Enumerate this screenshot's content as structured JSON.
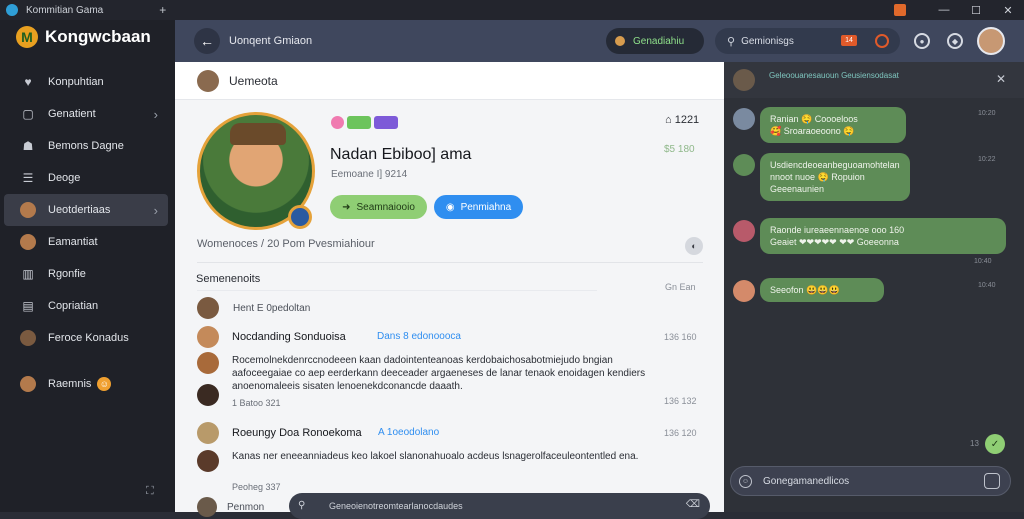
{
  "window": {
    "title": "Kommitian Gama",
    "tab_plus": "+",
    "minimize": "—",
    "maximize": "☐",
    "close": "✕"
  },
  "brand": {
    "name": "Kongwcbaan"
  },
  "sidebar": {
    "items": [
      {
        "label": "Konpuhtian"
      },
      {
        "label": "Genatient"
      },
      {
        "label": "Bemons Dagne"
      },
      {
        "label": "Deoge"
      },
      {
        "label": "Ueotdertiaas"
      },
      {
        "label": "Eamantiat"
      },
      {
        "label": "Rgonfie"
      },
      {
        "label": "Copriatian"
      },
      {
        "label": "Feroce Konadus"
      },
      {
        "label": "Raemnis"
      }
    ]
  },
  "topbar": {
    "title": "Uonqent Gmiaon",
    "status_pill": "Genadiahiu",
    "search_text": "Gemionisgs",
    "search_badge": "14"
  },
  "channel": {
    "title": "Uemeota"
  },
  "profile": {
    "name": "Nadan Ebiboo] ama",
    "subtitle": "Eemoane I] 9214",
    "btn_primary": "Seamnaiooio",
    "btn_secondary": "Penmiahna",
    "home_count": "1221",
    "amount": "$5 180",
    "section_line": "Womenoces  /  20  Pom Pvesmiahiour"
  },
  "comments": {
    "title": "Semenenoits",
    "meta": "Gn  Ean",
    "items": [
      {
        "meta": "Hent  E 0pedoltan",
        "time": ""
      },
      {
        "name": "Nocdanding  Sonduoisa",
        "tag": "Dans  8 edonoooca",
        "time": "136  160",
        "text": "Rocemolnekdenrccnodeeen kaan dadointenteanoas kerdobaichosabotmiejudo bngian aafoceegaiae co aep eerderkann deeceader argaeneses de lanar tenaok enoidagen kendiers anoenomaleeis sisaten lenoenekdconancde daaath.",
        "small": "1 Batoo 321",
        "time2": "136  132"
      },
      {
        "name": "Roeungy  Doa  Ronoekoma",
        "tag": "A 1oeodolano",
        "time": "136  120",
        "text": "Kanas ner eneeanniadeus keo lakoel slanonahuoalo acdeus lsnagerolfaceuleontentled ena.",
        "small": "Peoheg 337"
      }
    ]
  },
  "bottom": {
    "label": "Penmon",
    "composer_placeholder": "Geneoienotreomtearlanocdaudes",
    "send": "⌫"
  },
  "chat": {
    "top_text": "Geleoouanesauoun Geusiensodasat",
    "close": "✕",
    "bubbles": [
      {
        "text": "Ranian 🤤 Coooeloos\n🥰 Sroaraoeoono 🤤",
        "time": "10:20"
      },
      {
        "text": "Usdiencdeoeanbeguoamohtelan\nnnoot nuoe 🤤 Ropuion\nGeeenaunien",
        "time": "10:22"
      },
      {
        "text": "Raonde iureaeennaenoe ooo 160\nGeaiet  ❤❤❤❤❤ ❤❤ Goeeonna",
        "time": "10:40"
      },
      {
        "text": "Seeofon 😃😃😃",
        "time": "10:40"
      }
    ],
    "scroll_count": "13",
    "input_placeholder": "Gonegamanedlicos"
  },
  "colors": {
    "accent_green": "#8fce74",
    "accent_blue": "#2f8ef0",
    "bubble": "#5e8c57"
  }
}
